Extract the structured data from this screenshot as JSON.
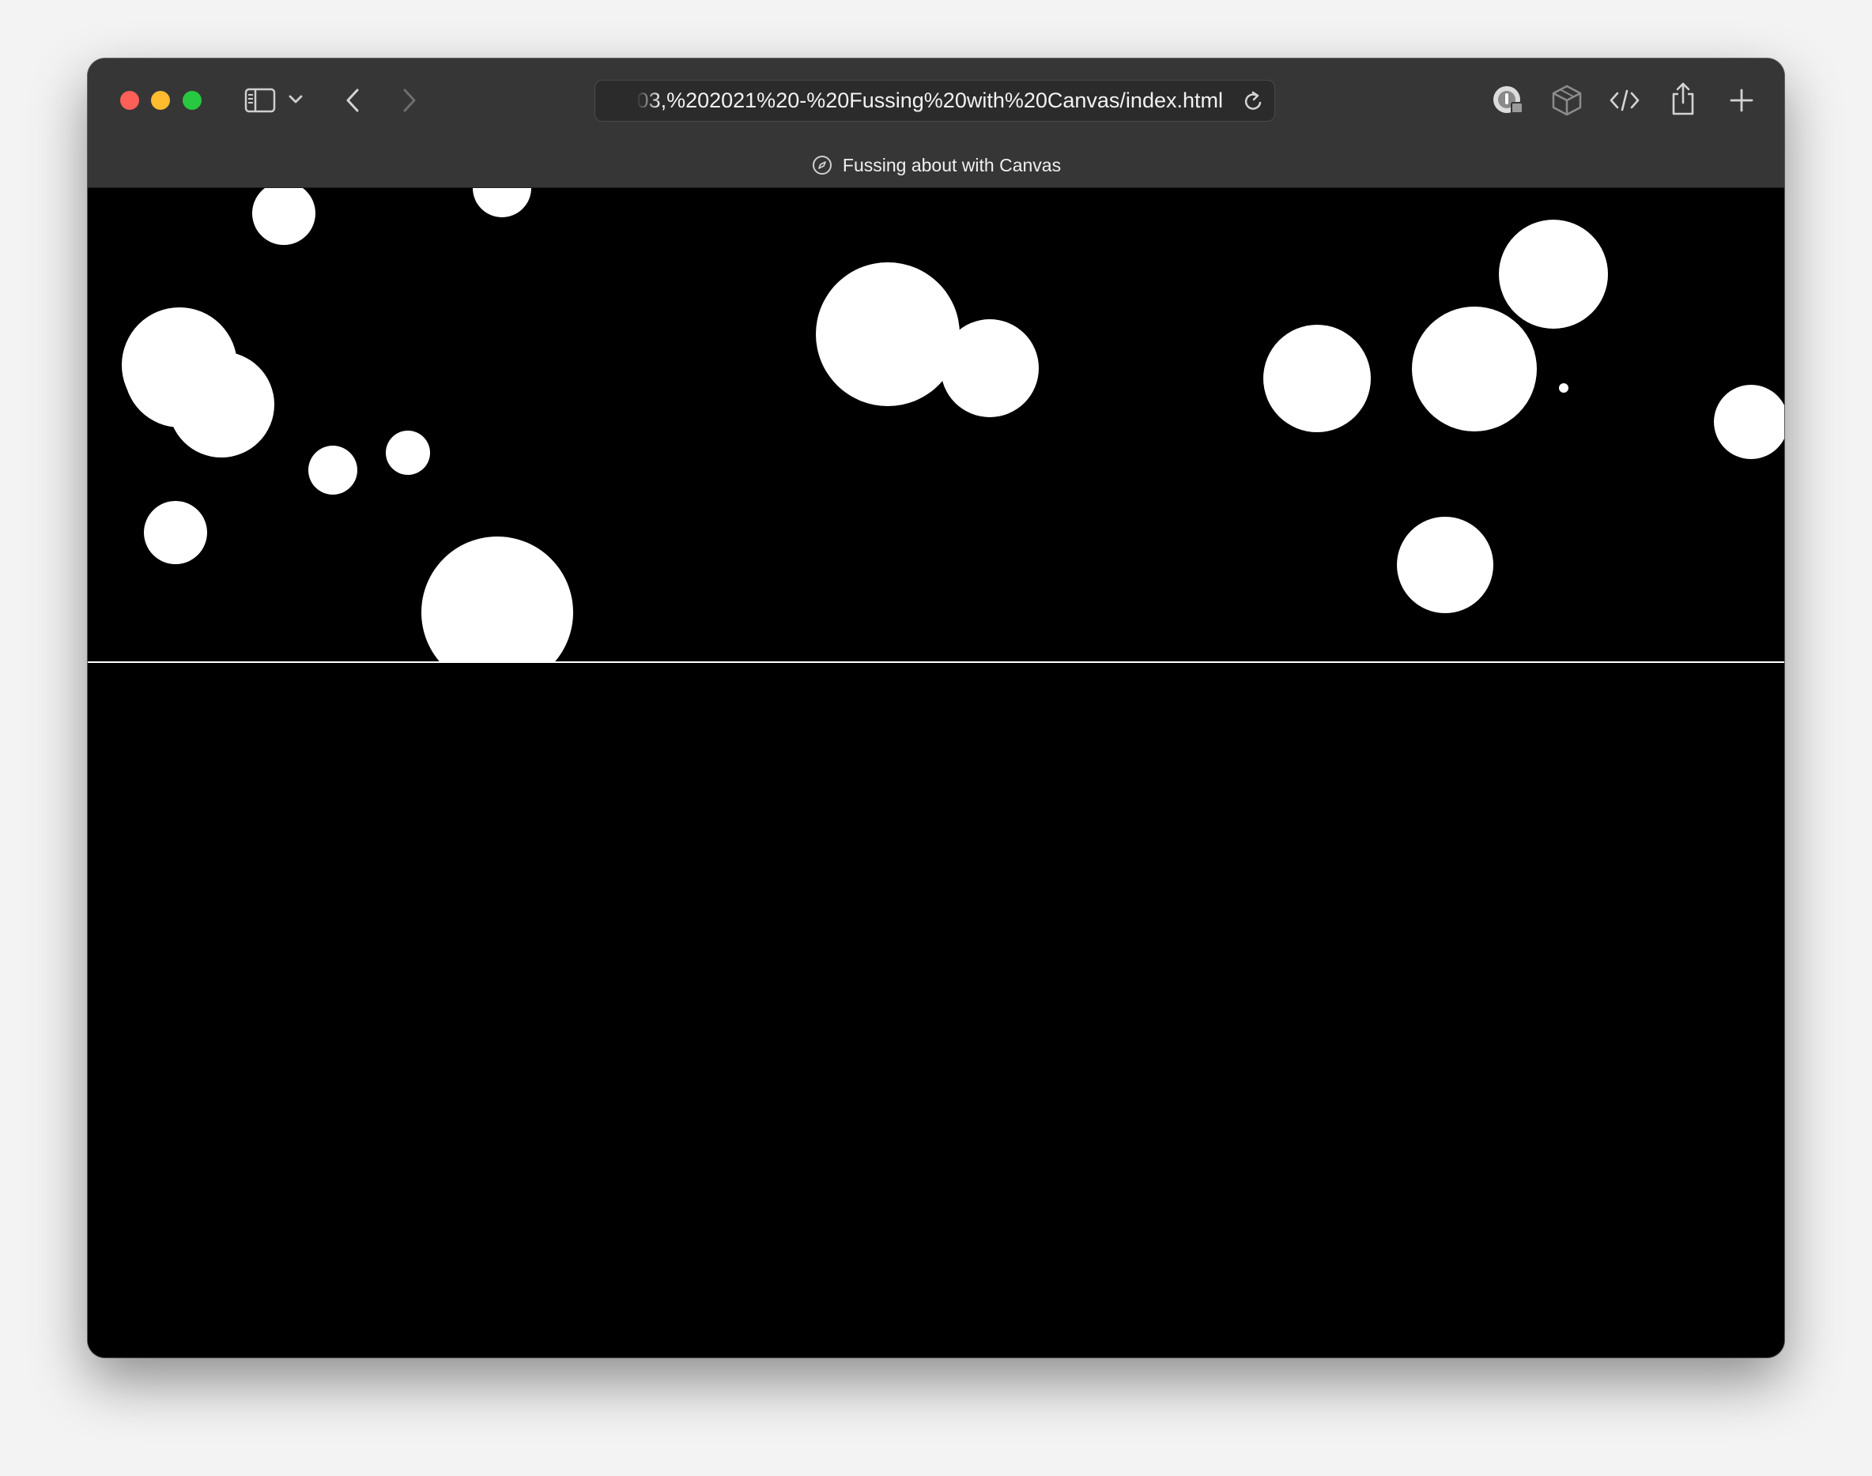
{
  "browser": {
    "url": "03,%202021%20-%20Fussing%20with%20Canvas/index.html",
    "tab_title": "Fussing about with Canvas"
  },
  "toolbar_icons": [
    "sidebar-toggle-icon",
    "chevron-down-icon",
    "back-arrow-icon",
    "forward-arrow-icon",
    "reload-icon",
    "password-extension-icon",
    "cube-extension-icon",
    "code-icon",
    "share-icon",
    "new-tab-plus-icon"
  ],
  "colors": {
    "canvas_background": "#000000",
    "circle_fill": "#ffffff",
    "toolbar_background": "#363636",
    "close": "#fe5f57",
    "minimize": "#febc2e",
    "maximize": "#28c840"
  }
}
